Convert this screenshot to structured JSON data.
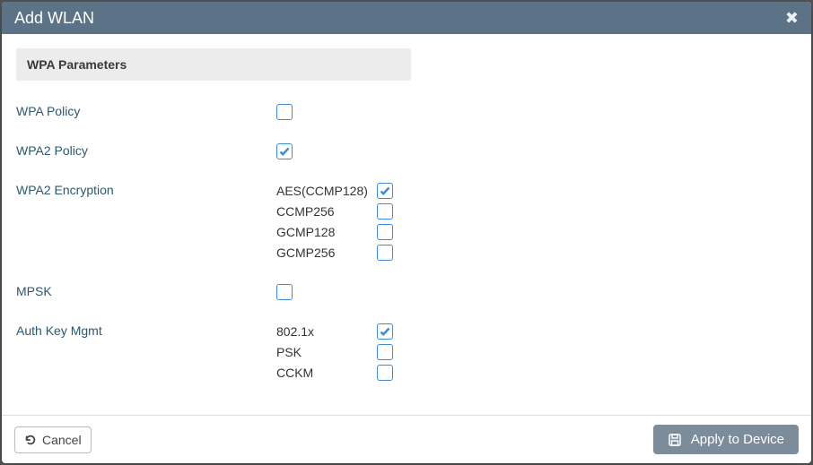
{
  "modal": {
    "title": "Add WLAN",
    "section_title": "WPA Parameters"
  },
  "fields": {
    "wpa_policy": {
      "label": "WPA Policy",
      "checked": false
    },
    "wpa2_policy": {
      "label": "WPA2 Policy",
      "checked": true
    },
    "wpa2_encryption": {
      "label": "WPA2 Encryption",
      "options": [
        {
          "label": "AES(CCMP128)",
          "checked": true
        },
        {
          "label": "CCMP256",
          "checked": false
        },
        {
          "label": "GCMP128",
          "checked": false
        },
        {
          "label": "GCMP256",
          "checked": false
        }
      ]
    },
    "mpsk": {
      "label": "MPSK",
      "checked": false
    },
    "auth_key_mgmt": {
      "label": "Auth Key Mgmt",
      "options": [
        {
          "label": "802.1x",
          "checked": true
        },
        {
          "label": "PSK",
          "checked": false
        },
        {
          "label": "CCKM",
          "checked": false
        }
      ]
    }
  },
  "footer": {
    "cancel": "Cancel",
    "apply": "Apply to Device"
  }
}
